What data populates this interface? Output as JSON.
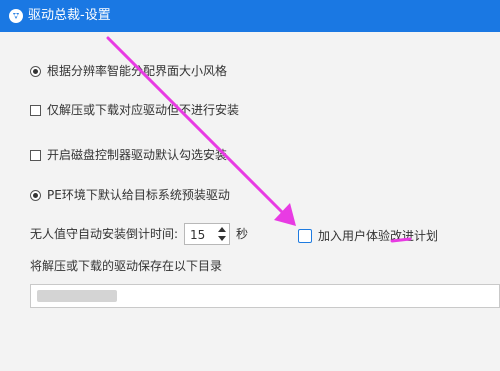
{
  "window": {
    "title": "驱动总裁-设置",
    "title_bar_color": "#1a78e3",
    "icon": "app-logo-icon"
  },
  "settings": {
    "auto_size_option": {
      "label": "根据分辨率智能分配界面大小风格",
      "checked": true
    },
    "extract_only_option": {
      "label": "仅解压或下载对应驱动但不进行安装",
      "checked": false
    },
    "disk_controller_option": {
      "label": "开启磁盘控制器驱动默认勾选安装",
      "checked": false
    },
    "pe_preinstall_option": {
      "label": "PE环境下默认给目标系统预装驱动",
      "checked": true
    },
    "countdown": {
      "label": "无人值守自动安装倒计时间:",
      "value": "15",
      "unit": "秒"
    },
    "user_experience_plan": {
      "label": "加入用户体验改进计划",
      "checked": false
    },
    "save_dir": {
      "label": "将解压或下载的驱动保存在以下目录",
      "value": ""
    }
  },
  "annotation": {
    "arrow_color": "#e83be3"
  }
}
